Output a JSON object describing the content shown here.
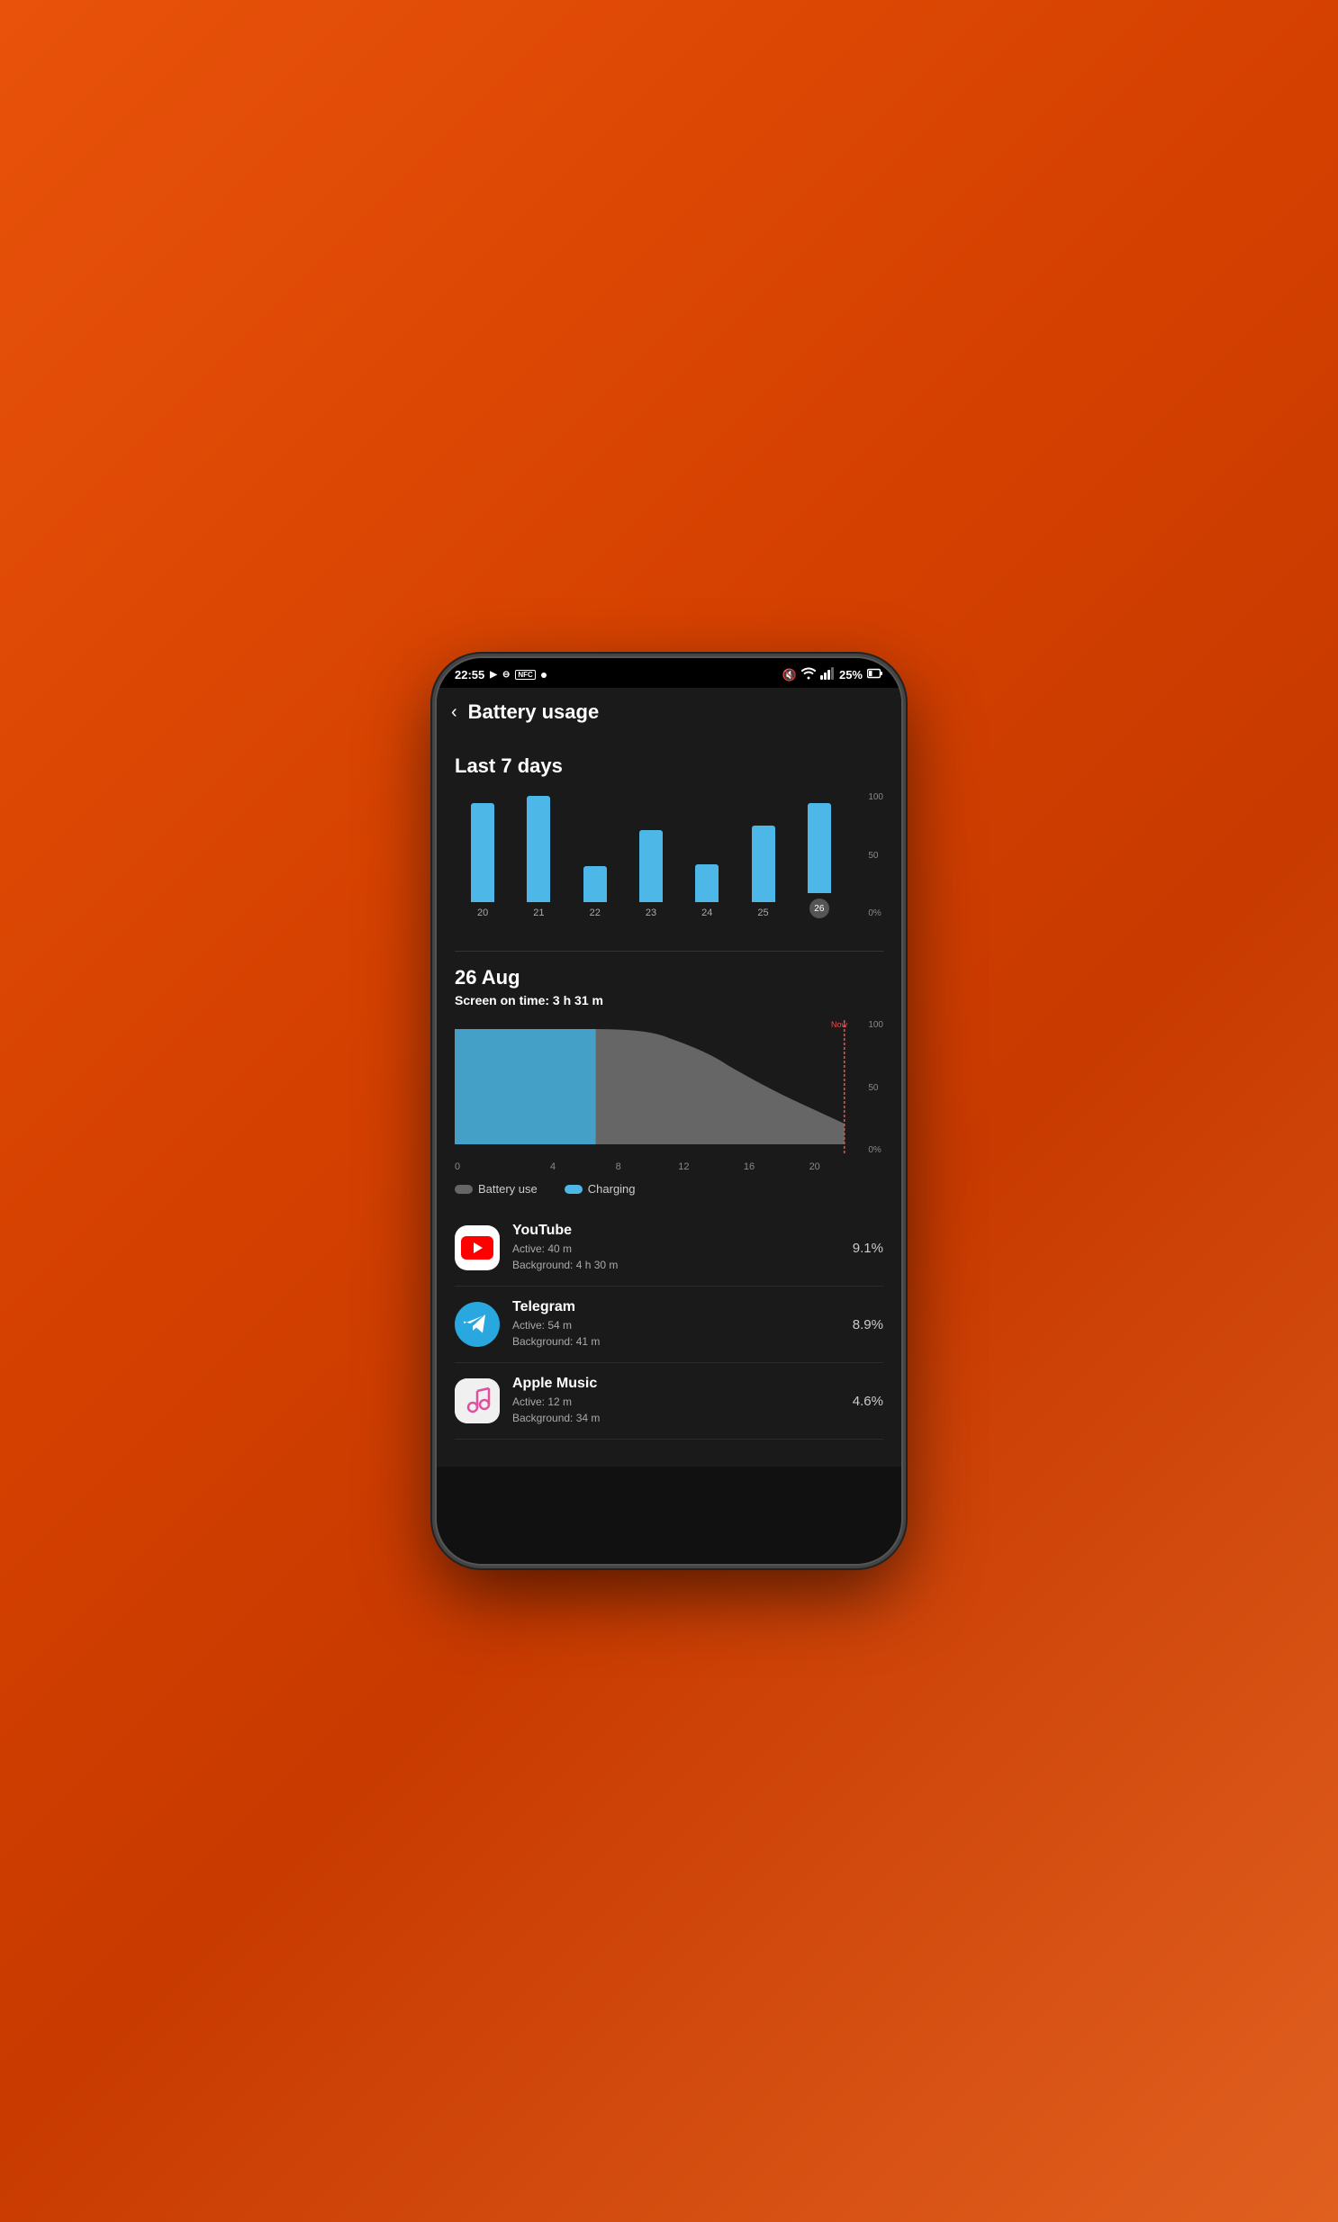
{
  "status": {
    "time": "22:55",
    "battery_percent": "25%",
    "icons_left": [
      "screen-record",
      "dnd",
      "nfc",
      "dot"
    ],
    "icons_right": [
      "mute",
      "wifi",
      "signal",
      "battery"
    ]
  },
  "header": {
    "back_label": "‹",
    "title": "Battery usage"
  },
  "weekly_chart": {
    "section_title": "Last 7 days",
    "y_labels": [
      "100",
      "50",
      "0%"
    ],
    "bars": [
      {
        "day": "20",
        "height": 110,
        "selected": false
      },
      {
        "day": "21",
        "height": 118,
        "selected": false
      },
      {
        "day": "22",
        "height": 40,
        "selected": false
      },
      {
        "day": "23",
        "height": 80,
        "selected": false
      },
      {
        "day": "24",
        "height": 42,
        "selected": false
      },
      {
        "day": "25",
        "height": 85,
        "selected": false
      },
      {
        "day": "26",
        "height": 100,
        "selected": true
      }
    ]
  },
  "daily_section": {
    "date": "26 Aug",
    "screen_on_time": "Screen on time: 3 h 31 m",
    "x_labels": [
      "0",
      "4",
      "8",
      "12",
      "16",
      "20"
    ],
    "y_labels": [
      "100",
      "50",
      "0%"
    ],
    "now_label": "Now",
    "legend": {
      "battery_use": "Battery use",
      "charging": "Charging"
    }
  },
  "apps": [
    {
      "name": "YouTube",
      "active": "Active: 40 m",
      "background": "Background: 4 h 30 m",
      "percentage": "9.1%",
      "icon_type": "youtube"
    },
    {
      "name": "Telegram",
      "active": "Active: 54 m",
      "background": "Background: 41 m",
      "percentage": "8.9%",
      "icon_type": "telegram"
    },
    {
      "name": "Apple Music",
      "active": "Active: 12 m",
      "background": "Background: 34 m",
      "percentage": "4.6%",
      "icon_type": "apple-music"
    }
  ]
}
